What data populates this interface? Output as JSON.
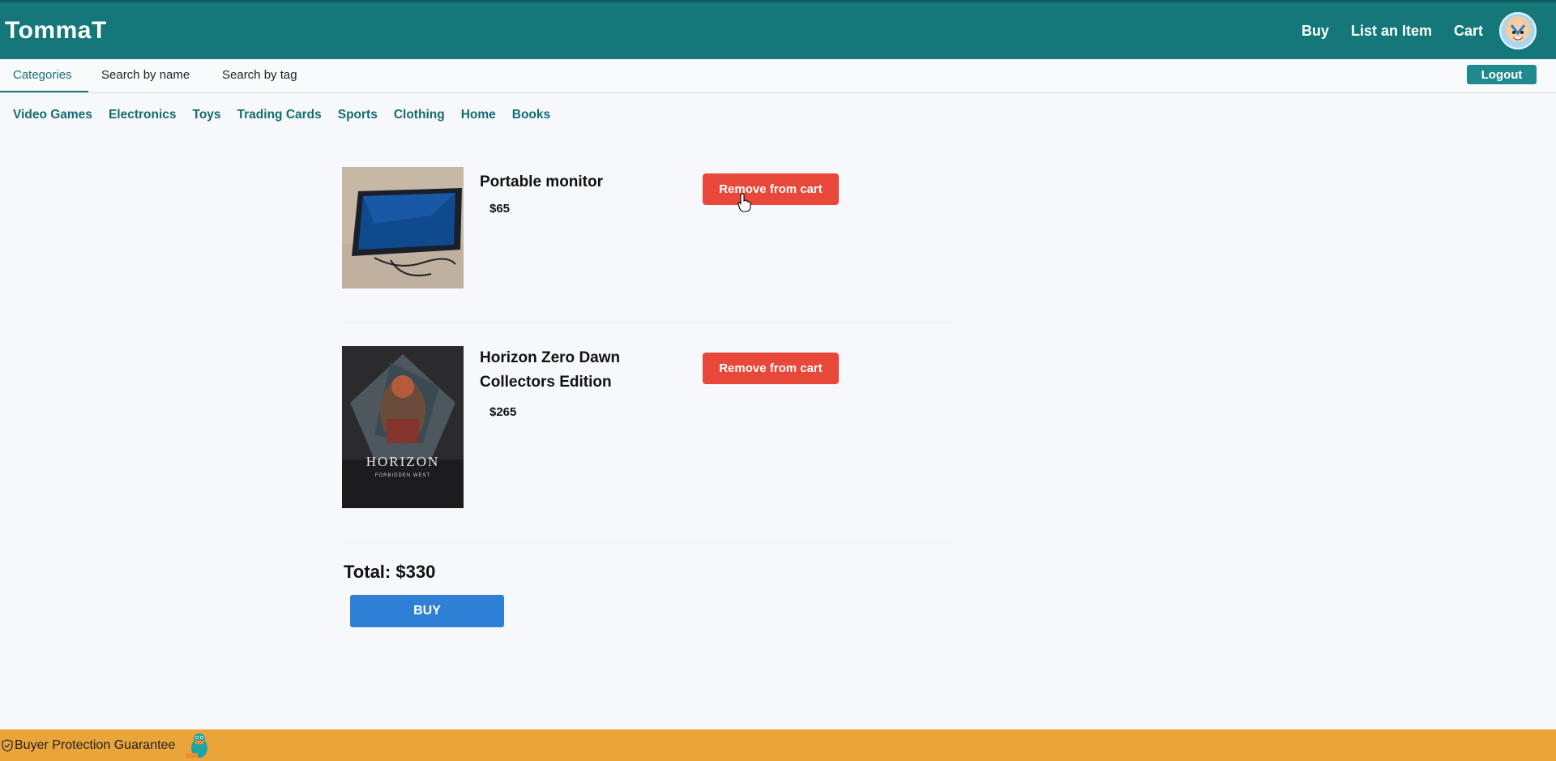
{
  "header": {
    "brand": "TommaT",
    "nav": [
      "Buy",
      "List an Item",
      "Cart"
    ]
  },
  "subnav": {
    "tabs": [
      "Categories",
      "Search by name",
      "Search by tag"
    ],
    "active_tab": "Categories",
    "logout_label": "Logout"
  },
  "categories": [
    "Video Games",
    "Electronics",
    "Toys",
    "Trading Cards",
    "Sports",
    "Clothing",
    "Home",
    "Books"
  ],
  "cart": {
    "items": [
      {
        "title": "Portable monitor",
        "price": "$65",
        "remove_label": "Remove from cart"
      },
      {
        "title": "Horizon Zero Dawn Collectors Edition",
        "price": "$265",
        "remove_label": "Remove from cart",
        "box_text": "HORIZON",
        "box_subtext": "FORBIDDEN WEST"
      }
    ],
    "total_label": "Total: $330",
    "buy_label": "BUY"
  },
  "footer": {
    "text": "Buyer Protection Guarantee"
  },
  "colors": {
    "header": "#147779",
    "remove": "#e8483a",
    "buy": "#2d80d6",
    "footer": "#e9a43a"
  }
}
